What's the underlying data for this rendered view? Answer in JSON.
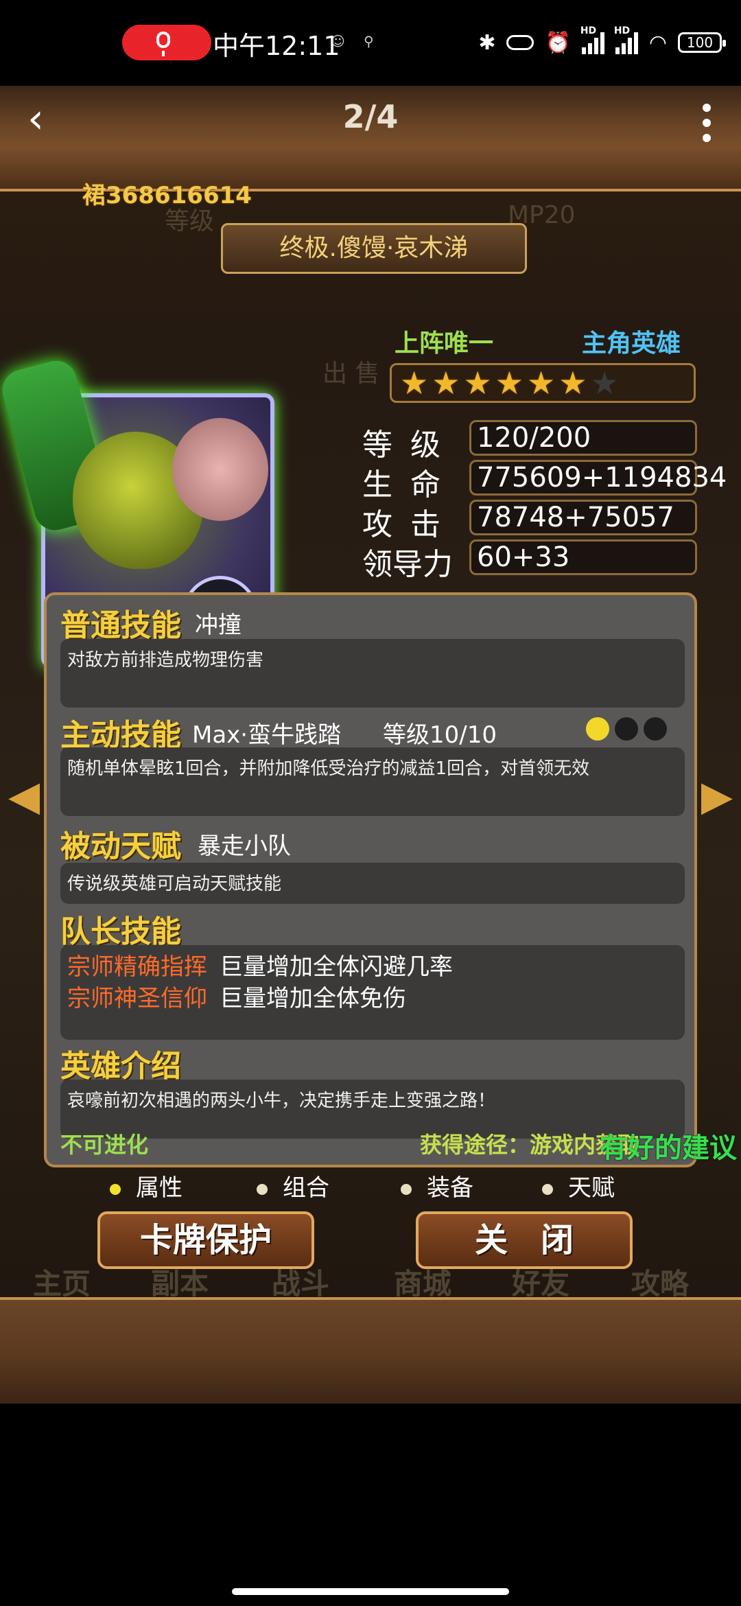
{
  "status_bar": {
    "time": "中午12:11",
    "battery": "100",
    "signal_label": "HD"
  },
  "header": {
    "page_indicator": "2/4",
    "group_number": "裙368616614",
    "hero_title": "终极.傻馒·哀木涕"
  },
  "hero": {
    "tag_unique": "上阵唯一",
    "tag_main": "主角英雄",
    "stars": {
      "filled": 6,
      "total": 7
    },
    "stats": [
      {
        "label": "等 级",
        "value": "120/200"
      },
      {
        "label": "生 命",
        "value": "775609+1194834"
      },
      {
        "label": "攻 击",
        "value": "78748+75057"
      },
      {
        "label": "领导力",
        "value": "60+33"
      }
    ]
  },
  "skills": {
    "normal": {
      "title": "普通技能",
      "name": "冲撞",
      "desc": "对敌方前排造成物理伤害"
    },
    "active": {
      "title": "主动技能",
      "name": "Max·蛮牛践踏",
      "level": "等级10/10",
      "desc": "随机单体晕眩1回合，并附加降低受治疗的减益1回合，对首领无效",
      "dots_on": 1,
      "dots_total": 3
    },
    "passive": {
      "title": "被动天赋",
      "name": "暴走小队",
      "desc": "传说级英雄可启动天赋技能"
    },
    "leader": {
      "title": "队长技能",
      "items": [
        {
          "name": "宗师精确指挥",
          "value": "巨量增加全体闪避几率"
        },
        {
          "name": "宗师神圣信仰",
          "value": "巨量增加全体免伤"
        }
      ]
    },
    "intro": {
      "title": "英雄介绍",
      "desc": "哀嚎前初次相遇的两头小牛，决定携手走上变强之路！"
    }
  },
  "footer_info": {
    "evolve": "不可进化",
    "source": "获得途径：游戏内获取",
    "watermark": "有好的建议"
  },
  "tabs": [
    "属性",
    "组合",
    "装备",
    "天赋"
  ],
  "buttons": {
    "protect": "卡牌保护",
    "close": "关　闭"
  },
  "bg_nav": [
    "主页",
    "副本",
    "战斗",
    "商城",
    "好友",
    "攻略"
  ],
  "colors": {
    "gold": "#f4d040",
    "accent_green": "#9ee04e",
    "accent_blue": "#4fc3f7",
    "leader_orange": "#ff6a2a"
  }
}
